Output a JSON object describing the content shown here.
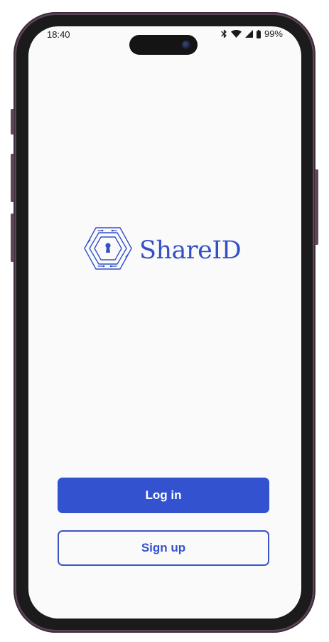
{
  "status_bar": {
    "time": "18:40",
    "battery": "99%",
    "icons": [
      "bluetooth-icon",
      "wifi-icon",
      "cellular-signal-icon",
      "battery-icon"
    ]
  },
  "logo": {
    "text": "ShareID",
    "icon": "hexagon-keyhole-icon",
    "color": "#3350c6"
  },
  "actions": {
    "login_label": "Log in",
    "signup_label": "Sign up"
  },
  "colors": {
    "accent": "#3352d0",
    "device_frame": "#5e4659",
    "screen_background": "#fafafa"
  }
}
